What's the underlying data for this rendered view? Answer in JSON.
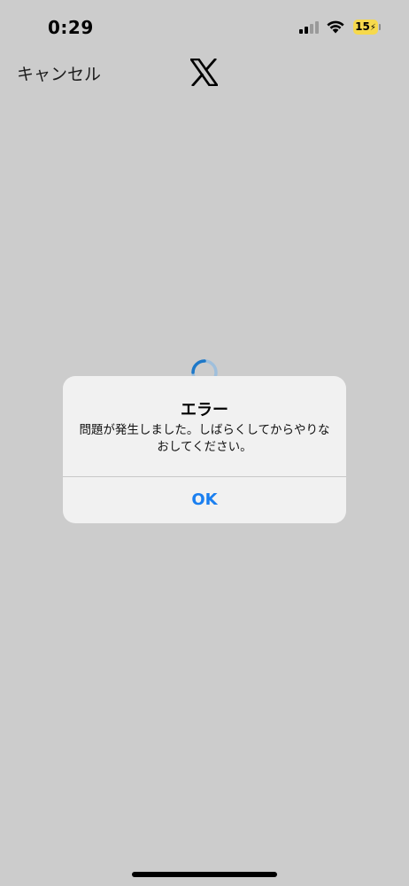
{
  "status_bar": {
    "time": "0:29",
    "battery_level": "15",
    "battery_color": "#f6d94c"
  },
  "header": {
    "cancel_label": "キャンセル",
    "logo_icon": "x-logo-icon"
  },
  "alert": {
    "title": "エラー",
    "message": "問題が発生しました。しばらくしてからやりなおしてください。",
    "ok_label": "OK",
    "ok_color": "#1a7ff0"
  },
  "loading": {
    "icon": "loading-spinner-icon",
    "accent_color": "#1d78c8"
  }
}
